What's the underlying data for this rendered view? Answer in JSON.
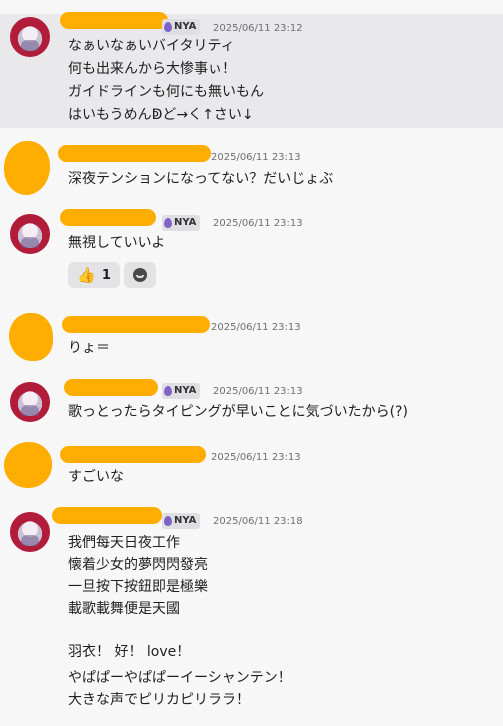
{
  "messages": [
    {
      "badge": "NYA",
      "time": "2025/06/11 23:12",
      "lines": [
        "なぁいなぁいバイタリティ",
        "何も出来んから大惨事ぃ！",
        "ガイドラインも何にも無いもん",
        "はいもうめんↁど→く↑さい↓"
      ]
    },
    {
      "time": "2025/06/11 23:13",
      "lines": [
        "深夜テンションになってない？だいじょぶ"
      ]
    },
    {
      "badge": "NYA",
      "time": "2025/06/11 23:13",
      "lines": [
        "無視していいよ"
      ],
      "reactions": [
        {
          "emoji": "👍",
          "count": "1"
        }
      ],
      "add_reaction_icon": "smiley-icon"
    },
    {
      "time": "2025/06/11 23:13",
      "lines": [
        "りょ＝"
      ]
    },
    {
      "badge": "NYA",
      "time": "2025/06/11 23:13",
      "lines": [
        "歌っとったらタイピングが早いことに気づいたから(?)"
      ]
    },
    {
      "time": "2025/06/11 23:13",
      "lines": [
        "すごいな"
      ]
    },
    {
      "badge": "NYA",
      "time": "2025/06/11 23:18",
      "lines": [
        "我們每天日夜工作",
        "懐着少女的夢閃閃發亮",
        "一旦按下按鈕即是極樂",
        "載歌載舞便是天國",
        "",
        "羽衣！ 好！ love！",
        "やぱぱーやぱぱーイーシャンテン！",
        "大きな声でピリカピリララ！"
      ]
    }
  ],
  "colors": {
    "redaction": "#ffad00",
    "highlight": "#e9e9ec",
    "badge_icon": "#7d62c8"
  }
}
